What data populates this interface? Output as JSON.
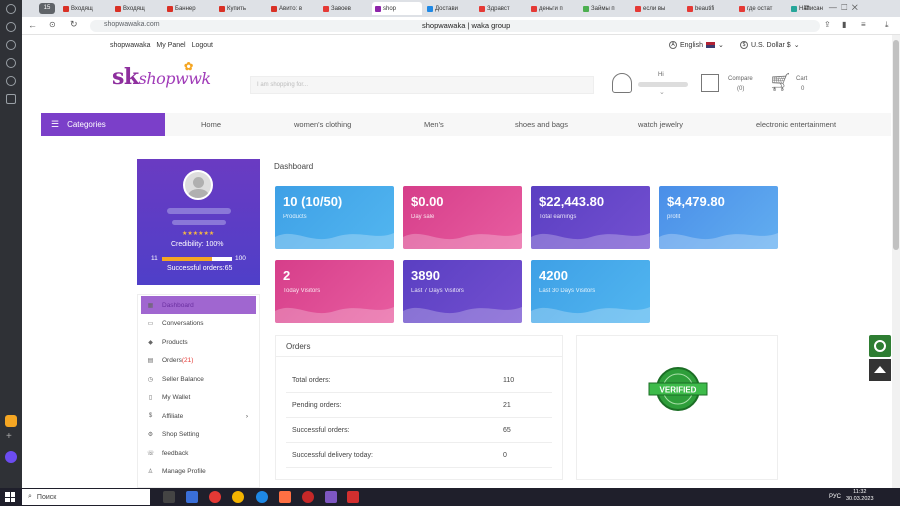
{
  "browser": {
    "tab_count": "15",
    "tabs": [
      {
        "label": "Входящ",
        "color": "#d93025"
      },
      {
        "label": "Входящ",
        "color": "#d93025"
      },
      {
        "label": "Баннер",
        "color": "#d93025"
      },
      {
        "label": "Купить",
        "color": "#d93025"
      },
      {
        "label": "Авито: в",
        "color": "#d93025"
      },
      {
        "label": "Завоев",
        "color": "#e53935"
      },
      {
        "label": "shop",
        "color": "#8e24aa",
        "active": true
      },
      {
        "label": "Достави",
        "color": "#1e88e5"
      },
      {
        "label": "Здравст",
        "color": "#e53935"
      },
      {
        "label": "деньги п",
        "color": "#e53935"
      },
      {
        "label": "Займы п",
        "color": "#4caf50"
      },
      {
        "label": "если вы",
        "color": "#e53935"
      },
      {
        "label": "beautifi",
        "color": "#e53935"
      },
      {
        "label": "где остат",
        "color": "#e53935"
      },
      {
        "label": "Написан",
        "color": "#26a69a"
      }
    ],
    "url": "shopwawaka.com",
    "page_title": "shopwawaka | waka group"
  },
  "site": {
    "top_links": [
      "shopwawaka",
      "My Panel",
      "Logout"
    ],
    "language": "English",
    "currency": "U.S. Dollar $",
    "logo_text": "skshopwwk",
    "search_placeholder": "I am shopping for...",
    "greeting": "Hi",
    "compare_label": "Compare",
    "compare_count": "(0)",
    "cart_label": "Cart",
    "cart_count": "0",
    "categories_label": "Categories",
    "nav": [
      "Home",
      "women's clothing",
      "Men's",
      "shoes and bags",
      "watch jewelry",
      "electronic entertainment"
    ]
  },
  "profile": {
    "stars": "★★★★★★",
    "credibility": "Credibility:  100%",
    "bar_min": "11",
    "bar_max": "100",
    "bar_fraction": 0.72,
    "successful_orders": "Successful orders:65"
  },
  "menu": [
    {
      "label": "Dashboard",
      "icon": "dashboard-icon",
      "glyph": "▦",
      "active": true
    },
    {
      "label": "Conversations",
      "icon": "chat-icon",
      "glyph": "▭"
    },
    {
      "label": "Products",
      "icon": "products-icon",
      "glyph": "◆"
    },
    {
      "label": "Orders",
      "icon": "orders-icon",
      "glyph": "▤",
      "badge": "(21)"
    },
    {
      "label": "Seller Balance",
      "icon": "balance-icon",
      "glyph": "◷"
    },
    {
      "label": "My Wallet",
      "icon": "wallet-icon",
      "glyph": "▯"
    },
    {
      "label": "Affiliate",
      "icon": "dollar-icon",
      "glyph": "$",
      "chevron": "›"
    },
    {
      "label": "Shop Setting",
      "icon": "settings-icon",
      "glyph": "⚙"
    },
    {
      "label": "feedback",
      "icon": "feedback-icon",
      "glyph": "☏"
    },
    {
      "label": "Manage Profile",
      "icon": "user-icon",
      "glyph": "♙"
    }
  ],
  "dashboard": {
    "title": "Dashboard",
    "cards": [
      {
        "value": "10 (10/50)",
        "label": "Products",
        "c1": "#3ea0e6",
        "c2": "#52b6f0"
      },
      {
        "value": "$0.00",
        "label": "Day sale",
        "c1": "#d63e8a",
        "c2": "#e85da0"
      },
      {
        "value": "$22,443.80",
        "label": "Total earnings",
        "c1": "#5a3fc2",
        "c2": "#7350d0"
      },
      {
        "value": "$4,479.80",
        "label": "profit",
        "c1": "#4a8ee8",
        "c2": "#62aef0"
      },
      {
        "value": "2",
        "label": "Today Visitors",
        "c1": "#d63e8a",
        "c2": "#e85da0"
      },
      {
        "value": "3890",
        "label": "Last 7 Days Visitors",
        "c1": "#5a3fc2",
        "c2": "#7350d0"
      },
      {
        "value": "4200",
        "label": "Last 30 Days Visitors",
        "c1": "#3ea0e6",
        "c2": "#52b6f0"
      }
    ]
  },
  "orders": {
    "title": "Orders",
    "rows": [
      {
        "label": "Total orders:",
        "value": "110"
      },
      {
        "label": "Pending orders:",
        "value": "21"
      },
      {
        "label": "Successful orders:",
        "value": "65"
      },
      {
        "label": "Successful delivery today:",
        "value": "0"
      }
    ]
  },
  "badge": {
    "text": "VERIFIED"
  },
  "taskbar": {
    "search": "Поиск",
    "lang": "РУС",
    "time": "11:32",
    "date": "30.03.2023"
  }
}
